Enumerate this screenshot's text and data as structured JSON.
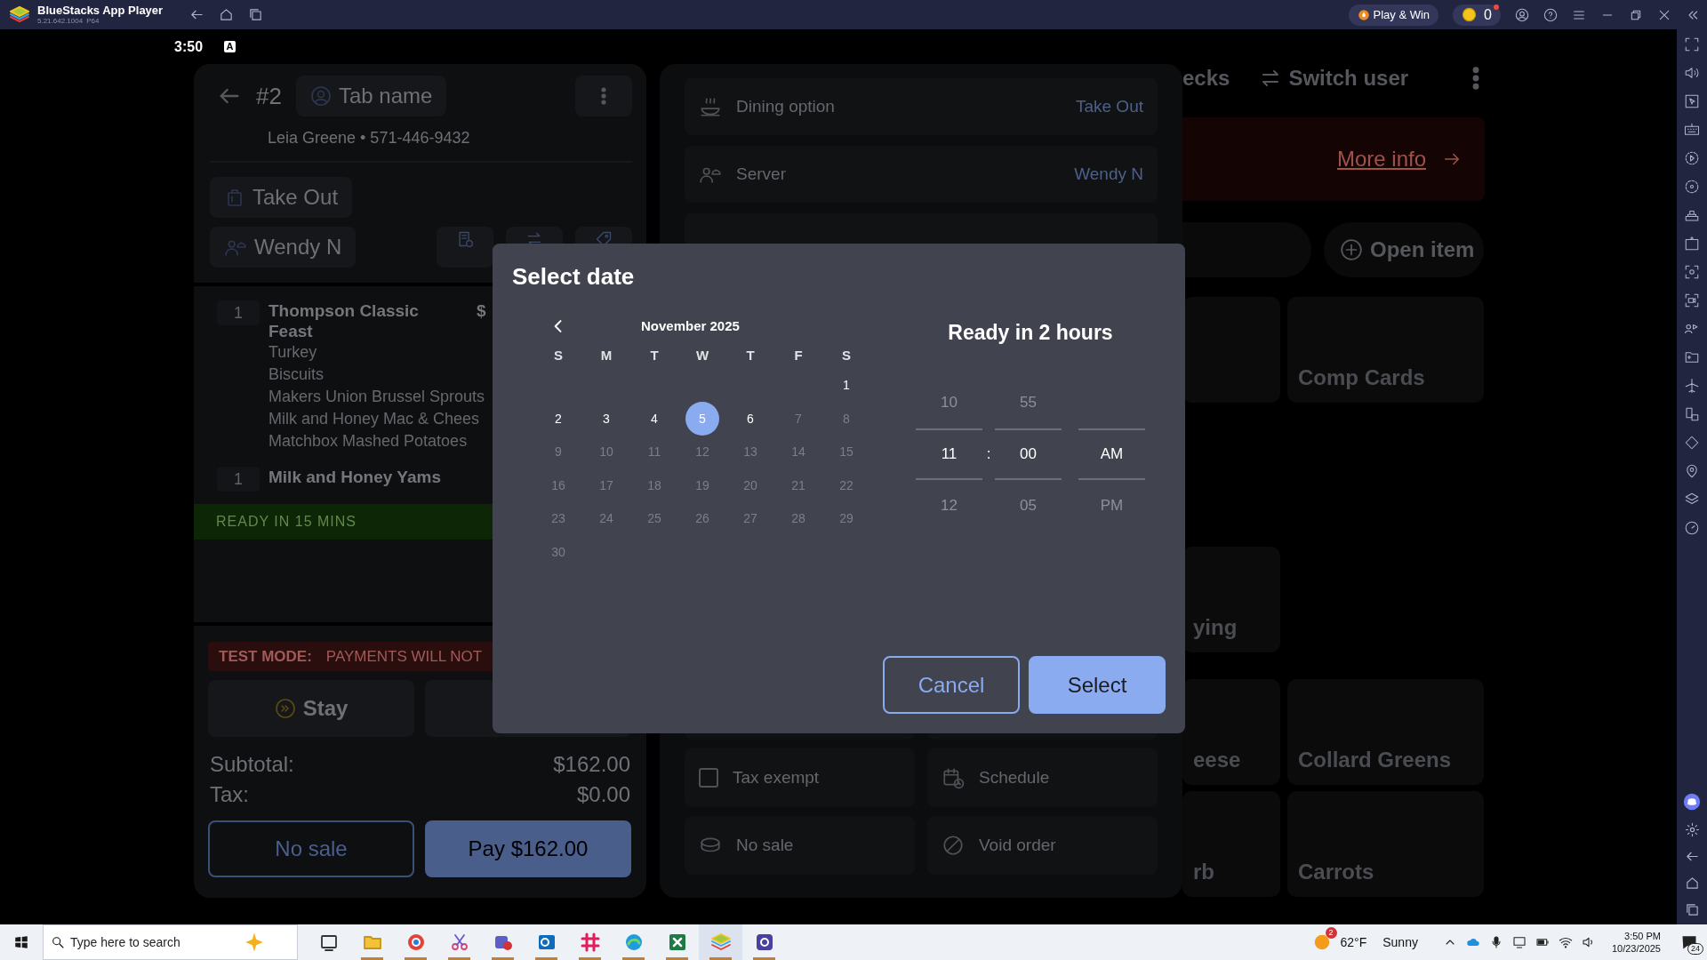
{
  "app_window": {
    "title": "BlueStacks App Player",
    "version": "5.21.642.1004",
    "build": "P64",
    "play_button": "Play & Win",
    "coins": "0",
    "notification_dot": true
  },
  "status_bar": {
    "time": "3:50",
    "indicator": "A"
  },
  "order_panel": {
    "number": "#2",
    "tab_name": "Tab name",
    "customer": "Leia Greene • 571-446-9432",
    "dining_button": "Take Out",
    "server_button": "Wendy N",
    "items": [
      {
        "qty": "1",
        "name": "Thompson Classic Feast",
        "price": "$",
        "modifiers": [
          "Turkey",
          "Biscuits",
          "Makers Union Brussel Sprouts",
          "Milk and Honey Mac & Chees",
          "Matchbox Mashed Potatoes"
        ]
      },
      {
        "qty": "1",
        "name": "Milk and Honey Yams"
      }
    ],
    "ready_banner": "READY IN 15 MINS",
    "test_mode": {
      "label": "TEST MODE:",
      "message": "PAYMENTS WILL NOT"
    },
    "stay_button": "Stay",
    "totals": [
      {
        "label": "Subtotal:",
        "value": "$162.00"
      },
      {
        "label": "Tax:",
        "value": "$0.00"
      }
    ],
    "no_sale_button": "No sale",
    "pay_button": "Pay $162.00"
  },
  "options_panel": {
    "rows": [
      {
        "label": "Dining option",
        "value": "Take Out"
      },
      {
        "label": "Server",
        "value": "Wendy N"
      }
    ],
    "actions": [
      {
        "kind": "checkbox",
        "label": "Tax exempt",
        "checked": false
      },
      {
        "kind": "button",
        "label": "Schedule"
      },
      {
        "kind": "button",
        "label": "No sale"
      },
      {
        "kind": "button",
        "label": "Void order"
      }
    ]
  },
  "menu_panel": {
    "checks_tab": "ecks",
    "switch_user": "Switch user",
    "banner_link": "More info",
    "open_item": "Open item",
    "tile_sections": [
      {
        "leading_blank": true,
        "tiles": [
          {
            "label": "Comp Cards"
          }
        ]
      },
      {
        "tiles": [
          {
            "label": "ying"
          }
        ]
      },
      {
        "tiles": [
          {
            "label": "eese"
          },
          {
            "label": "Collard Greens"
          },
          {
            "label": "rb"
          },
          {
            "label": "Carrots"
          }
        ]
      }
    ]
  },
  "dialog": {
    "title": "Select date",
    "month": "November 2025",
    "weekdays": [
      "S",
      "M",
      "T",
      "W",
      "T",
      "F",
      "S"
    ],
    "weeks": [
      [
        {
          "day": "1",
          "disabled": false,
          "selected": false
        }
      ],
      [
        {
          "day": "2",
          "disabled": false,
          "selected": false
        },
        {
          "day": "3",
          "disabled": false,
          "selected": false
        },
        {
          "day": "4",
          "disabled": false,
          "selected": false
        },
        {
          "day": "5",
          "disabled": false,
          "selected": true
        },
        {
          "day": "6",
          "disabled": false,
          "selected": false
        },
        {
          "day": "7",
          "disabled": true,
          "selected": false
        },
        {
          "day": "8",
          "disabled": true,
          "selected": false
        }
      ],
      [
        {
          "day": "9",
          "disabled": true,
          "selected": false
        },
        {
          "day": "10",
          "disabled": true,
          "selected": false
        },
        {
          "day": "11",
          "disabled": true,
          "selected": false
        },
        {
          "day": "12",
          "disabled": true,
          "selected": false
        },
        {
          "day": "13",
          "disabled": true,
          "selected": false
        },
        {
          "day": "14",
          "disabled": true,
          "selected": false
        },
        {
          "day": "15",
          "disabled": true,
          "selected": false
        }
      ],
      [
        {
          "day": "16",
          "disabled": true,
          "selected": false
        },
        {
          "day": "17",
          "disabled": true,
          "selected": false
        },
        {
          "day": "18",
          "disabled": true,
          "selected": false
        },
        {
          "day": "19",
          "disabled": true,
          "selected": false
        },
        {
          "day": "20",
          "disabled": true,
          "selected": false
        },
        {
          "day": "21",
          "disabled": true,
          "selected": false
        },
        {
          "day": "22",
          "disabled": true,
          "selected": false
        }
      ],
      [
        {
          "day": "23",
          "disabled": true,
          "selected": false
        },
        {
          "day": "24",
          "disabled": true,
          "selected": false
        },
        {
          "day": "25",
          "disabled": true,
          "selected": false
        },
        {
          "day": "26",
          "disabled": true,
          "selected": false
        },
        {
          "day": "27",
          "disabled": true,
          "selected": false
        },
        {
          "day": "28",
          "disabled": true,
          "selected": false
        },
        {
          "day": "29",
          "disabled": true,
          "selected": false
        }
      ],
      [
        {
          "day": "30",
          "disabled": true,
          "selected": false
        }
      ]
    ],
    "time_heading": "Ready in 2 hours",
    "separator": ":",
    "time_columns": [
      {
        "items": [
          {
            "label": "10",
            "selected": false
          },
          {
            "label": "11",
            "selected": true
          },
          {
            "label": "12",
            "selected": false
          }
        ]
      },
      {
        "items": [
          {
            "label": "55",
            "selected": false
          },
          {
            "label": "00",
            "selected": true
          },
          {
            "label": "05",
            "selected": false
          }
        ]
      },
      {
        "items": [
          {
            "label": "AM",
            "selected": true
          },
          {
            "label": "PM",
            "selected": false
          }
        ]
      }
    ],
    "buttons": [
      {
        "label": "Cancel",
        "kind": "secondary"
      },
      {
        "label": "Select",
        "kind": "primary"
      }
    ]
  },
  "taskbar": {
    "search_placeholder": "Type here to search",
    "apps": [
      {
        "running": false,
        "active": false
      },
      {
        "running": true,
        "active": false
      },
      {
        "running": true,
        "active": false
      },
      {
        "running": true,
        "active": false
      },
      {
        "running": true,
        "active": false
      },
      {
        "running": true,
        "active": false
      },
      {
        "running": true,
        "active": false
      },
      {
        "running": true,
        "active": false
      },
      {
        "running": true,
        "active": false
      },
      {
        "running": true,
        "active": true
      },
      {
        "running": true,
        "active": false
      }
    ],
    "weather": {
      "badge": "2",
      "temperature": "62°F",
      "condition": "Sunny"
    },
    "clock": {
      "time": "3:50 PM",
      "date": "10/23/2025"
    },
    "notifications": "24"
  }
}
